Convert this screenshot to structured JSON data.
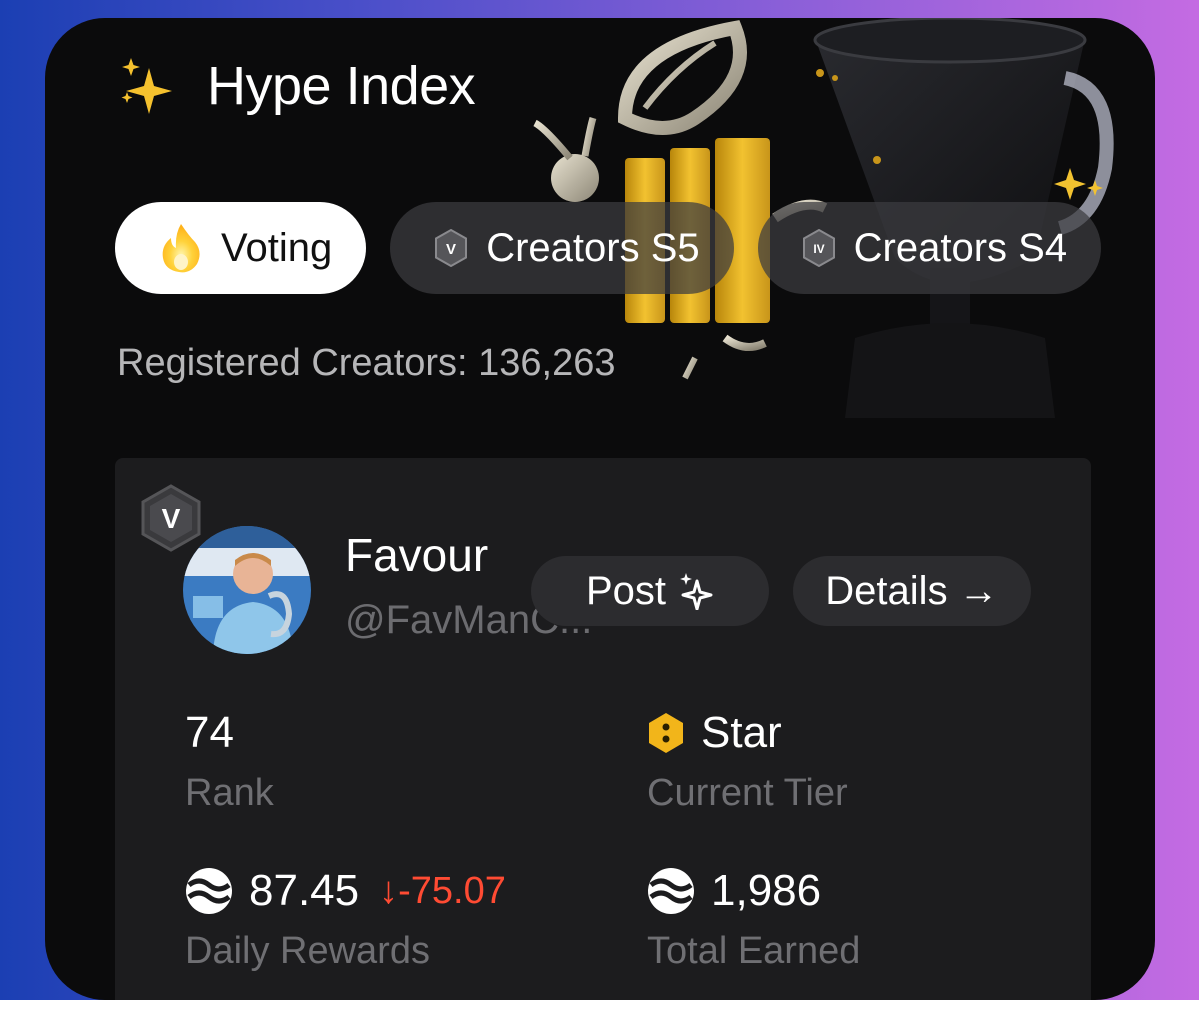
{
  "header": {
    "title": "Hype Index",
    "icon": "sparkles-icon"
  },
  "tabs": [
    {
      "label": "Voting",
      "icon": "fire-icon",
      "active": true
    },
    {
      "label": "Creators S5",
      "badge": "V",
      "active": false
    },
    {
      "label": "Creators S4",
      "badge": "IV",
      "active": false
    }
  ],
  "registered": {
    "text": "Registered Creators: 136,263"
  },
  "creator": {
    "season_badge": "V",
    "name": "Favour",
    "handle": "@FavManC...",
    "post_label": "Post",
    "details_label": "Details →"
  },
  "stats": {
    "rank": {
      "value": "74",
      "label": "Rank"
    },
    "tier": {
      "value": "Star",
      "label": "Current Tier"
    },
    "daily": {
      "value": "87.45",
      "delta": "↓-75.07",
      "label": "Daily Rewards"
    },
    "total": {
      "value": "1,986",
      "label": "Total Earned"
    }
  },
  "colors": {
    "accent_negative": "#ff4b33",
    "tier_gold": "#f2b51a",
    "card_bg": "#0b0b0c",
    "panel_bg": "#1c1c1e"
  }
}
